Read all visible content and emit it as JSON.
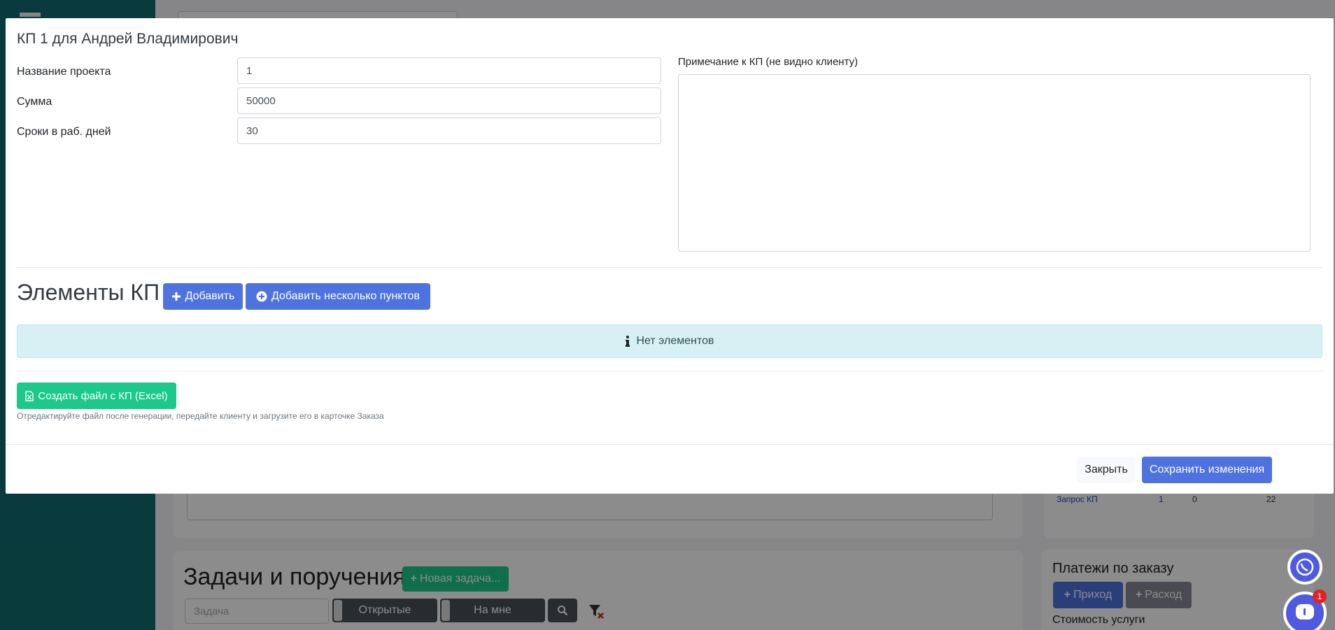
{
  "modal": {
    "title": "КП 1 для Андрей Владимирович",
    "fields": [
      {
        "label": "Название проекта",
        "value": "1"
      },
      {
        "label": "Сумма",
        "value": "50000"
      },
      {
        "label": "Сроки в раб. дней",
        "value": "30"
      }
    ],
    "note_label": "Примечание к КП (не видно клиенту)",
    "note_value": "",
    "section_title": "Элементы КП",
    "add_label": "Добавить",
    "add_many_label": "Добавить несколько пунктов",
    "empty_message": "Нет элементов",
    "excel_label": "Создать файл с КП (Excel)",
    "hint": "Отредактируйте файл после генерации, передайте клиенту и загрузите его в карточке Заказа",
    "close_label": "Закрыть",
    "save_label": "Сохранить изменения"
  },
  "background": {
    "tasks_title": "Задачи и поручения",
    "new_task_label": "Новая задача...",
    "task_placeholder": "Задача",
    "filter_open": "Открытые",
    "filter_mine": "На мне",
    "payments_title": "Платежи по заказу",
    "income_label": "Приход",
    "expense_label": "Расход",
    "service_cost_label": "Стоимость услуги",
    "request_link": "Запрос КП",
    "request_count": "1",
    "request_zero": "0",
    "request_days": "22",
    "chat_badge": "1"
  },
  "colors": {
    "sidebar": "#116b6f",
    "primary": "#4e73df",
    "success": "#1cc88a",
    "info_bg": "#d7f0f3"
  }
}
